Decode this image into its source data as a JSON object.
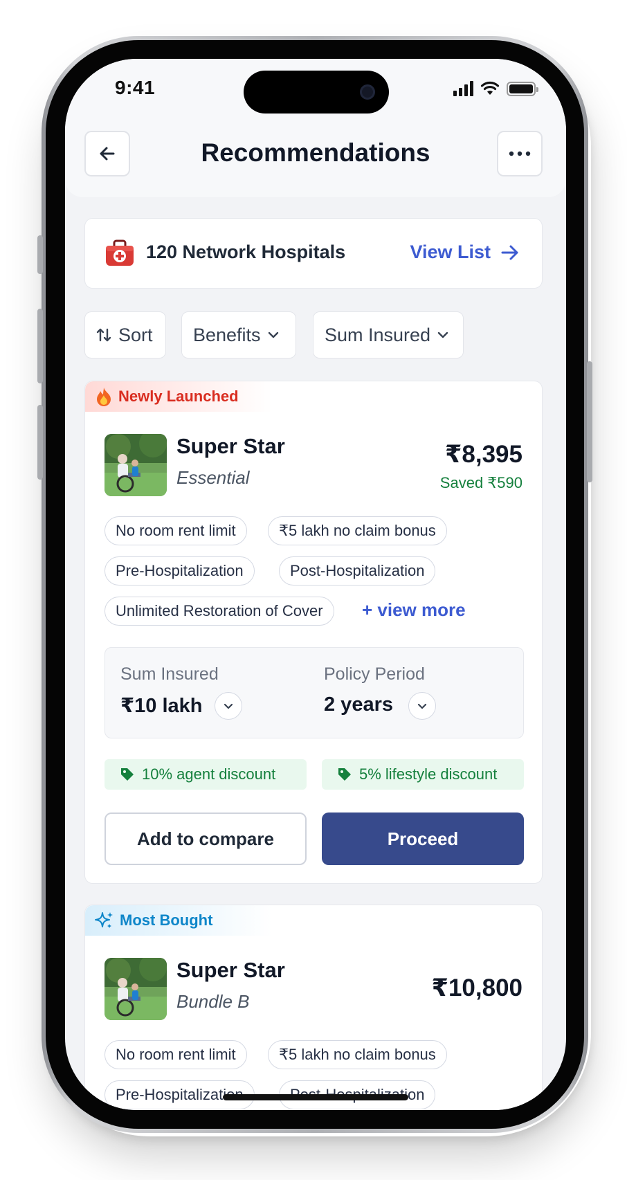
{
  "status": {
    "time": "9:41"
  },
  "header": {
    "title": "Recommendations",
    "back_icon": "arrow-left-icon",
    "more_icon": "more-horizontal-icon"
  },
  "network": {
    "label": "120 Network Hospitals",
    "link": "View List",
    "icon": "medical-kit-icon"
  },
  "filters": [
    {
      "label": "Sort",
      "icon": "sort-icon"
    },
    {
      "label": "Benefits",
      "icon": "chevron-down-icon"
    },
    {
      "label": "Sum Insured",
      "icon": "chevron-down-icon"
    }
  ],
  "plans": [
    {
      "ribbon": "Newly Launched",
      "ribbon_icon": "fire-icon",
      "ribbon_color": "#d92d20",
      "name": "Super Star",
      "variant": "Essential",
      "price": "₹8,395",
      "saved": "Saved ₹590",
      "features": [
        "No room rent limit",
        "₹5 lakh no claim bonus",
        "Pre-Hospitalization",
        "Post-Hospitalization",
        "Unlimited Restoration of Cover"
      ],
      "view_more": "+ view more",
      "sum_insured_label": "Sum Insured",
      "sum_insured_value": "₹10 lakh",
      "policy_period_label": "Policy Period",
      "policy_period_value": "2 years",
      "discounts": [
        "10% agent discount",
        "5% lifestyle discount"
      ],
      "compare_label": "Add to compare",
      "proceed_label": "Proceed"
    },
    {
      "ribbon": "Most Bought",
      "ribbon_icon": "sparkle-icon",
      "ribbon_color": "#0e86c9",
      "name": "Super Star",
      "variant": "Bundle B",
      "price": "₹10,800",
      "features": [
        "No room rent limit",
        "₹5 lakh no claim bonus",
        "Pre-Hospitalization",
        "Post-Hospitalization"
      ]
    }
  ],
  "colors": {
    "accent": "#3d5bd1",
    "primary_button": "#374a8c",
    "success": "#15803d"
  }
}
